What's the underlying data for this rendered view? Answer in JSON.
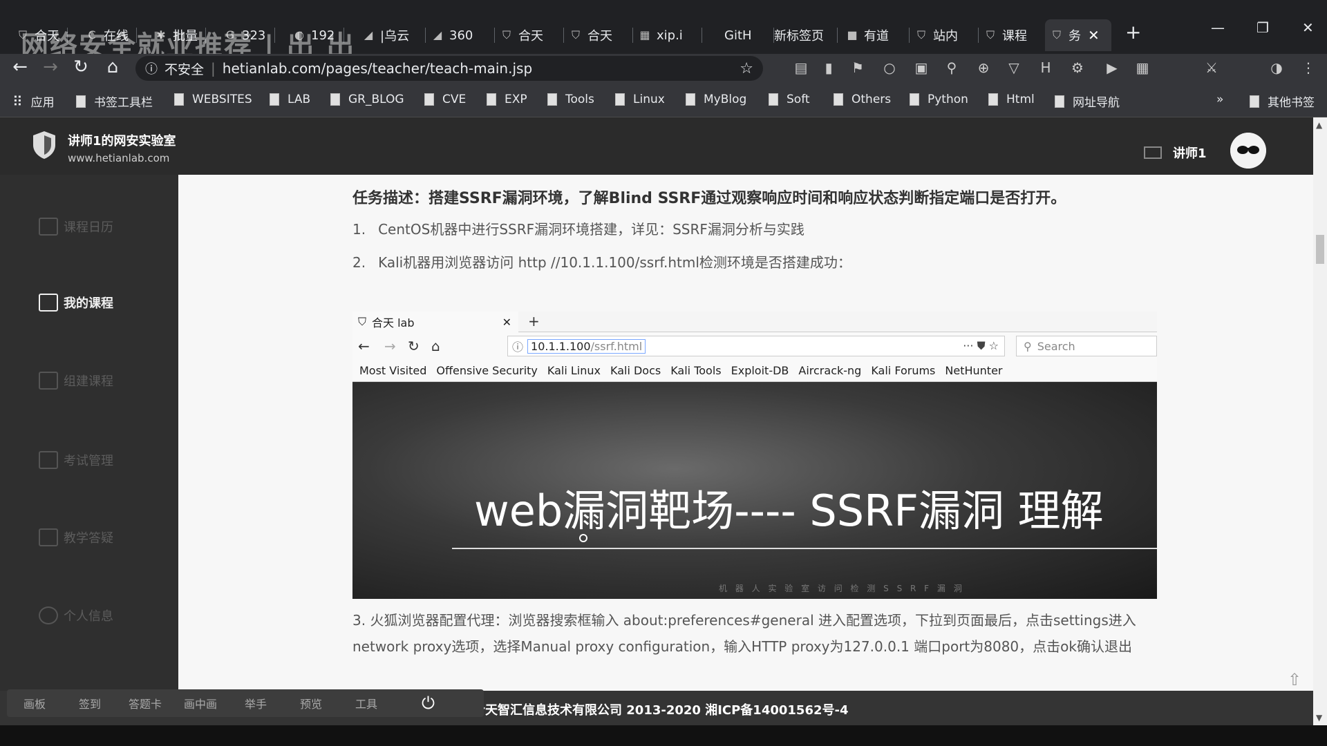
{
  "tabs": [
    {
      "label": "合天",
      "icon": "shield-icon"
    },
    {
      "label": "在线",
      "icon": "c-icon"
    },
    {
      "label": "批量",
      "icon": "puzzle-icon"
    },
    {
      "label": "323",
      "icon": "g-icon"
    },
    {
      "label": "192",
      "icon": "ghost-icon"
    },
    {
      "label": "|乌云",
      "icon": "drop-icon"
    },
    {
      "label": "360",
      "icon": "drop-icon"
    },
    {
      "label": "合天",
      "icon": "shield-icon"
    },
    {
      "label": "合天",
      "icon": "shield-icon"
    },
    {
      "label": "xip.i",
      "icon": "grid-icon"
    },
    {
      "label": "GitH",
      "icon": "github-icon"
    },
    {
      "label": "新标签页",
      "icon": "blank-icon"
    },
    {
      "label": "有道",
      "icon": "square-icon"
    },
    {
      "label": "站内",
      "icon": "shield-icon"
    },
    {
      "label": "课程",
      "icon": "shield-icon"
    },
    {
      "label": "务",
      "icon": "shield-icon",
      "active": true
    }
  ],
  "overlay_title": "网络安全就业推荐 | 出 出",
  "toolbar": {
    "insecure_label": "不安全",
    "url": "hetianlab.com/pages/teacher/teach-main.jsp"
  },
  "bookmarks": [
    "应用",
    "书签工具栏",
    "WEBSITES",
    "LAB",
    "GR_BLOG",
    "CVE",
    "EXP",
    "Tools",
    "Linux",
    "MyBlog",
    "Soft",
    "Others",
    "Python",
    "Html",
    "网址导航"
  ],
  "bookmarks_more": "»",
  "bookmarks_other": "其他书签",
  "site": {
    "name": "讲师1的网安实验室",
    "domain": "www.hetianlab.com",
    "user": "讲师1"
  },
  "sidebar": [
    {
      "label": "课程日历",
      "active": false
    },
    {
      "label": "我的课程",
      "active": true
    },
    {
      "label": "组建课程",
      "active": false
    },
    {
      "label": "考试管理",
      "active": false
    },
    {
      "label": "教学答疑",
      "active": false
    },
    {
      "label": "个人信息",
      "active": false
    }
  ],
  "content": {
    "task": "任务描述：搭建SSRF漏洞环境，了解Blind SSRF通过观察响应时间和响应状态判断指定端口是否打开。",
    "step1_num": "1.",
    "step1": "CentOS机器中进行SSRF漏洞环境搭建，详见：SSRF漏洞分析与实践",
    "step2_num": "2.",
    "step2": "Kali机器用浏览器访问 http //10.1.1.100/ssrf.html检测环境是否搭建成功：",
    "step3": "3.   火狐浏览器配置代理：浏览器搜索框输入 about:preferences#general 进入配置选项，下拉到页面最后，点击settings进入network proxy选项，选择Manual proxy configuration，输入HTTP proxy为127.0.0.1   端口port为8080，点击ok确认退出"
  },
  "ff": {
    "tab_title": "合天 lab",
    "url_host": "10.1.1.100",
    "url_path": "/ssrf.html",
    "search_placeholder": "Search",
    "bookmarks": [
      "Most Visited",
      "Offensive Security",
      "Kali Linux",
      "Kali Docs",
      "Kali Tools",
      "Exploit-DB",
      "Aircrack-ng",
      "Kali Forums",
      "NetHunter"
    ],
    "hero_title": "web漏洞靶场---- SSRF漏洞 理解",
    "hero_sub": "机 器 人 实 验 室 访 问 检 测 S S R F 漏 洞"
  },
  "bottom_toolbar": [
    "画板",
    "签到",
    "答题卡",
    "画中画",
    "举手",
    "预览",
    "工具"
  ],
  "footer": "：湖南合天智汇信息技术有限公司 2013-2020 湘ICP备14001562号-4"
}
